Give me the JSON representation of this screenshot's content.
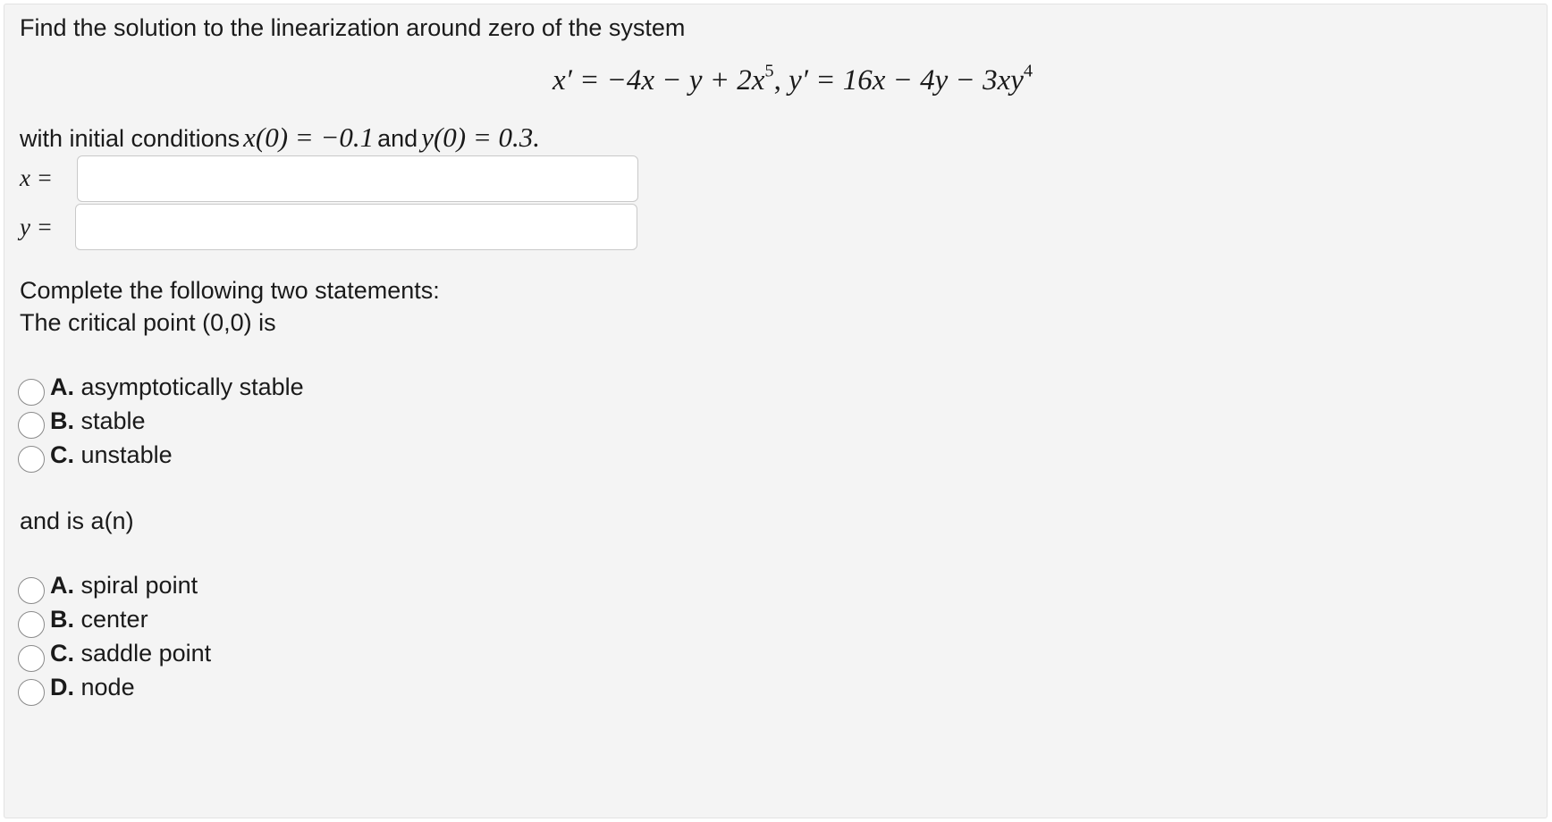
{
  "question": {
    "prompt": "Find the solution to the linearization around zero of the system",
    "equation": {
      "x_prime": "x′ = −4x − y + 2x",
      "x_exp": "5",
      "separator": ", ",
      "y_prime": "y′ = 16x − 4y − 3xy",
      "y_exp": "4"
    },
    "initial_conditions": {
      "lead": "with initial conditions",
      "x0": "x(0) = −0.1",
      "and": "and",
      "y0": "y(0) = 0.3."
    },
    "x_label": "x =",
    "y_label": "y =",
    "x_value": "",
    "y_value": ""
  },
  "statements": {
    "intro": "Complete the following two statements:",
    "first": "The critical point (0,0) is",
    "first_options": [
      {
        "letter": "A.",
        "text": "asymptotically stable"
      },
      {
        "letter": "B.",
        "text": "stable"
      },
      {
        "letter": "C.",
        "text": "unstable"
      }
    ],
    "second": "and is a(n)",
    "second_options": [
      {
        "letter": "A.",
        "text": "spiral point"
      },
      {
        "letter": "B.",
        "text": "center"
      },
      {
        "letter": "C.",
        "text": "saddle point"
      },
      {
        "letter": "D.",
        "text": "node"
      }
    ]
  }
}
